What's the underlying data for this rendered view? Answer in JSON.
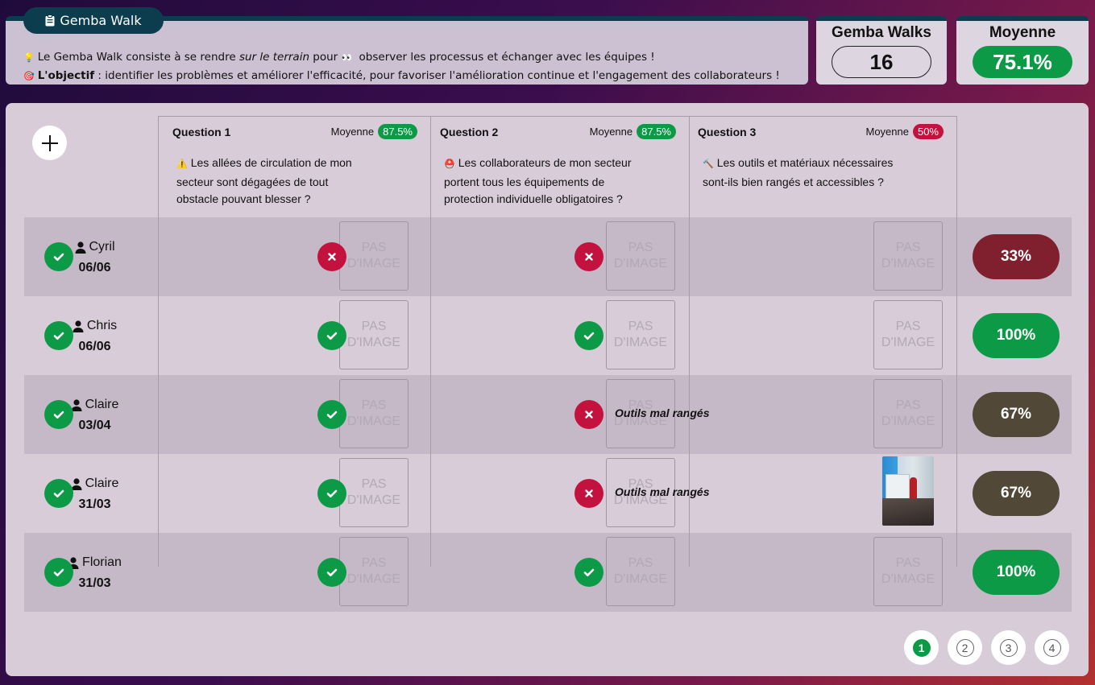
{
  "header": {
    "tab_label": "Gemba Walk",
    "line1_pre": "Le Gemba Walk consiste à se rendre ",
    "line1_em": "sur le terrain",
    "line1_mid": " pour ",
    "line1_post": " observer les processus et échanger avec les équipes !",
    "line2_bold": "L'objectif",
    "line2_rest": " : identifier les problèmes et améliorer l'efficacité, pour favoriser l'amélioration continue et l'engagement des collaborateurs !"
  },
  "stats": {
    "walks_title": "Gemba Walks",
    "walks_value": "16",
    "avg_title": "Moyenne",
    "avg_value": "75.1%"
  },
  "questions": [
    {
      "title": "Question 1",
      "avg_label": "Moyenne",
      "avg": "87.5%",
      "avg_color": "#0d9a47",
      "icon": "warning-icon",
      "text_lines": [
        "Les allées de circulation de mon",
        "secteur sont dégagées de tout",
        "obstacle pouvant blesser ?"
      ]
    },
    {
      "title": "Question 2",
      "avg_label": "Moyenne",
      "avg": "87.5%",
      "avg_color": "#0d9a47",
      "icon": "helmet-icon",
      "text_lines": [
        "Les collaborateurs de mon secteur",
        "portent tous les équipements de",
        "protection individuelle obligatoires ?"
      ]
    },
    {
      "title": "Question 3",
      "avg_label": "Moyenne",
      "avg": "50%",
      "avg_color": "#c3123d",
      "icon": "hammer-icon",
      "text_lines": [
        "Les outils et matériaux nécessaires",
        "sont-ils bien rangés et accessibles ?"
      ]
    }
  ],
  "no_image_line1": "PAS",
  "no_image_line2": "D'IMAGE",
  "rows": [
    {
      "name": "Cyril",
      "date": "06/06",
      "answers": [
        {
          "ok": true,
          "comment": "",
          "image": false
        },
        {
          "ok": false,
          "comment": "",
          "image": false
        },
        {
          "ok": false,
          "comment": "",
          "image": false
        }
      ],
      "score": "33%",
      "score_color": "#80202e"
    },
    {
      "name": "Chris",
      "date": "06/06",
      "answers": [
        {
          "ok": true,
          "comment": "",
          "image": false
        },
        {
          "ok": true,
          "comment": "",
          "image": false
        },
        {
          "ok": true,
          "comment": "",
          "image": false
        }
      ],
      "score": "100%",
      "score_color": "#0d9a47"
    },
    {
      "name": "Claire",
      "date": "03/04",
      "answers": [
        {
          "ok": true,
          "comment": "",
          "image": false
        },
        {
          "ok": true,
          "comment": "",
          "image": false
        },
        {
          "ok": false,
          "comment": "Outils mal rangés",
          "image": false
        }
      ],
      "score": "67%",
      "score_color": "#514838"
    },
    {
      "name": "Claire",
      "date": "31/03",
      "answers": [
        {
          "ok": true,
          "comment": "",
          "image": false
        },
        {
          "ok": true,
          "comment": "",
          "image": false
        },
        {
          "ok": false,
          "comment": "Outils mal rangés",
          "image": true
        }
      ],
      "score": "67%",
      "score_color": "#514838"
    },
    {
      "name": "Florian",
      "date": "31/03",
      "answers": [
        {
          "ok": true,
          "comment": "",
          "image": false
        },
        {
          "ok": true,
          "comment": "",
          "image": false
        },
        {
          "ok": true,
          "comment": "",
          "image": false
        }
      ],
      "score": "100%",
      "score_color": "#0d9a47"
    }
  ],
  "pagination": {
    "pages": [
      "1",
      "2",
      "3",
      "4"
    ],
    "active": "1"
  }
}
